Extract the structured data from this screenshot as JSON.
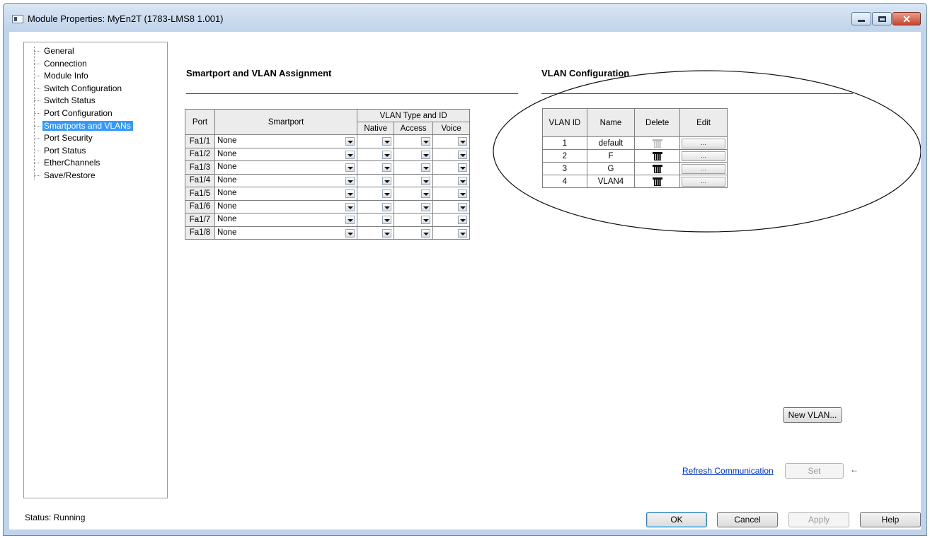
{
  "window": {
    "title": "Module Properties: MyEn2T (1783-LMS8 1.001)",
    "icon": "app-window-icon",
    "controls": [
      "minimize-icon",
      "maximize-icon",
      "close-icon"
    ],
    "close_glyph": "✕"
  },
  "tree": {
    "items": [
      {
        "label": "General"
      },
      {
        "label": "Connection"
      },
      {
        "label": "Module Info"
      },
      {
        "label": "Switch Configuration"
      },
      {
        "label": "Switch Status"
      },
      {
        "label": "Port Configuration"
      },
      {
        "label": "Smartports and VLANs",
        "selected": true
      },
      {
        "label": "Port Security"
      },
      {
        "label": "Port Status"
      },
      {
        "label": "EtherChannels"
      },
      {
        "label": "Save/Restore"
      }
    ]
  },
  "smartport_section": {
    "title": "Smartport and VLAN Assignment",
    "headers": {
      "port": "Port",
      "smartport": "Smartport",
      "vlan_group": "VLAN Type and ID",
      "native": "Native",
      "access": "Access",
      "voice": "Voice"
    },
    "rows": [
      {
        "port": "Fa1/1",
        "smartport": "None",
        "native": "",
        "access": "",
        "voice": ""
      },
      {
        "port": "Fa1/2",
        "smartport": "None",
        "native": "",
        "access": "",
        "voice": ""
      },
      {
        "port": "Fa1/3",
        "smartport": "None",
        "native": "",
        "access": "",
        "voice": ""
      },
      {
        "port": "Fa1/4",
        "smartport": "None",
        "native": "",
        "access": "",
        "voice": ""
      },
      {
        "port": "Fa1/5",
        "smartport": "None",
        "native": "",
        "access": "",
        "voice": ""
      },
      {
        "port": "Fa1/6",
        "smartport": "None",
        "native": "",
        "access": "",
        "voice": ""
      },
      {
        "port": "Fa1/7",
        "smartport": "None",
        "native": "",
        "access": "",
        "voice": ""
      },
      {
        "port": "Fa1/8",
        "smartport": "None",
        "native": "",
        "access": "",
        "voice": ""
      }
    ]
  },
  "vlan_section": {
    "title": "VLAN Configuration",
    "headers": {
      "id": "VLAN ID",
      "name": "Name",
      "delete": "Delete",
      "edit": "Edit"
    },
    "rows": [
      {
        "id": "1",
        "name": "default",
        "deletable": false,
        "edit_label": "..."
      },
      {
        "id": "2",
        "name": "F",
        "deletable": true,
        "edit_label": "..."
      },
      {
        "id": "3",
        "name": "G",
        "deletable": true,
        "edit_label": "..."
      },
      {
        "id": "4",
        "name": "VLAN4",
        "deletable": true,
        "edit_label": "..."
      }
    ],
    "new_vlan_label": "New VLAN..."
  },
  "refresh": {
    "link_label": "Refresh Communication",
    "set_label": "Set",
    "indicator": "←"
  },
  "status_bar": {
    "text": "Status:  Running"
  },
  "footer_buttons": {
    "ok": "OK",
    "cancel": "Cancel",
    "apply": "Apply",
    "help": "Help"
  }
}
